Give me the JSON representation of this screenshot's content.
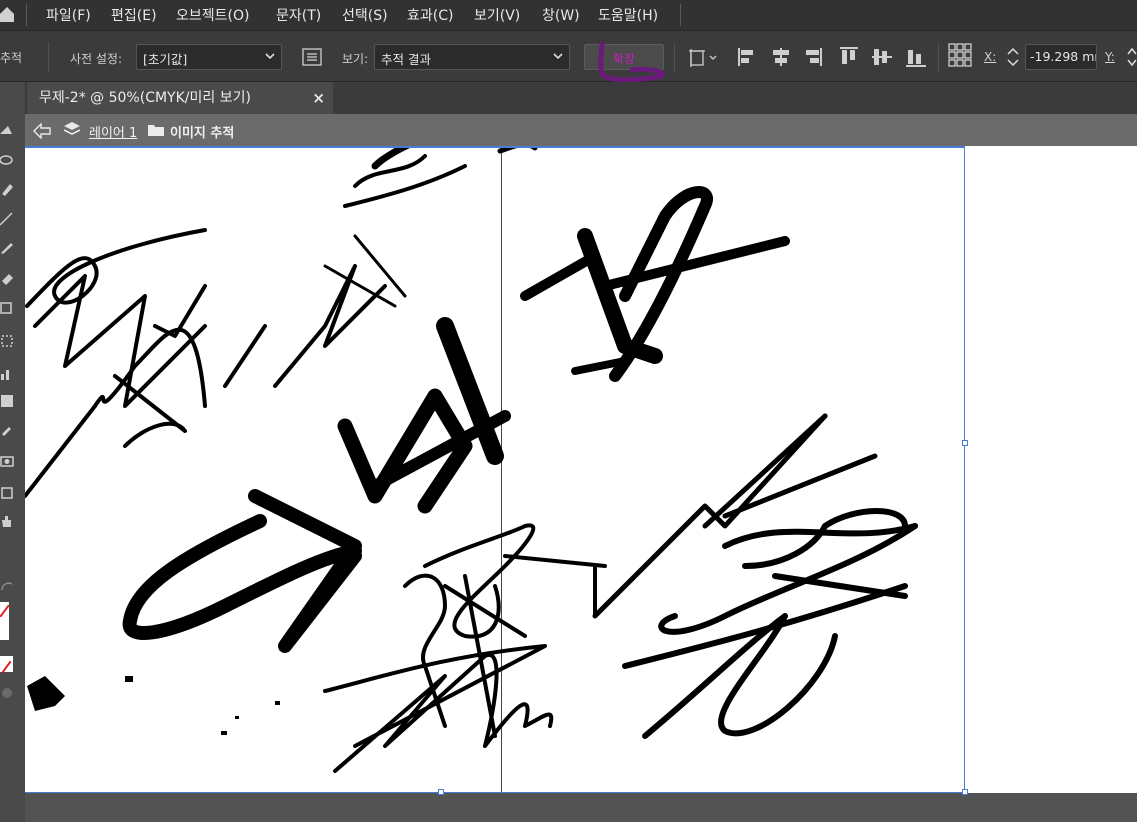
{
  "menu": {
    "items": [
      "파일(F)",
      "편집(E)",
      "오브젝트(O)",
      "문자(T)",
      "선택(S)",
      "효과(C)",
      "보기(V)",
      "창(W)",
      "도움말(H)"
    ]
  },
  "control_bar": {
    "panel_name": "추적",
    "preset_label": "사전 설정:",
    "preset_value": "[초기값]",
    "view_label": "보기:",
    "view_value": "추적 결과",
    "expand_button": "확장",
    "x_label": "X:",
    "x_value": "-19.298 mn",
    "y_label": "Y:"
  },
  "document": {
    "tab_title": "무제-2* @ 50%(CMYK/미리 보기)",
    "close_glyph": "×"
  },
  "isolation": {
    "layer": "레이어 1",
    "object": "이미지 추적"
  },
  "colors": {
    "menubar_bg": "#323232",
    "controlbar_bg": "#3b3b3b",
    "isolation_bg": "#6b6b6b",
    "selection_blue": "#4a7bd6",
    "annotation_purple": "#6a1b7a"
  },
  "icons": [
    "home-icon",
    "chevron-down-icon",
    "transform-icon",
    "align-icons",
    "stepper-icon",
    "reference-point-icon",
    "back-arrow-icon",
    "layers-icon",
    "folder-icon"
  ]
}
